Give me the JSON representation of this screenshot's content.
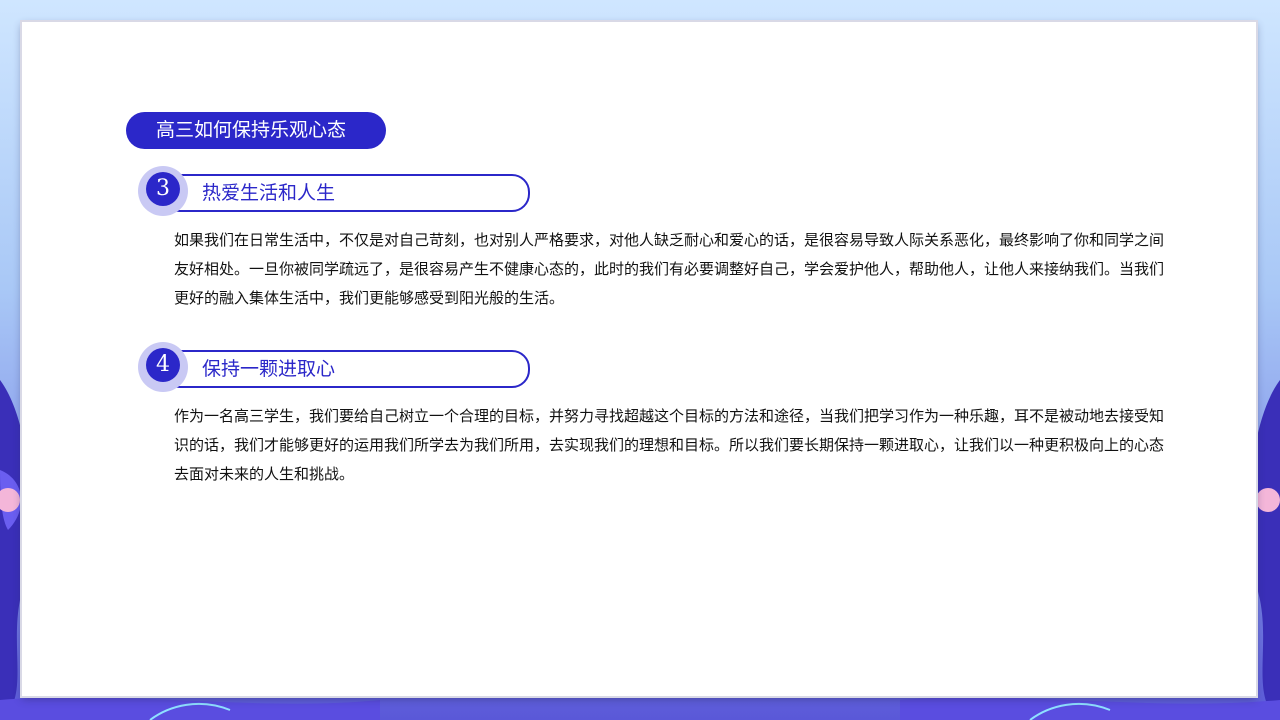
{
  "title": "高三如何保持乐观心态",
  "sections": [
    {
      "number": "3",
      "heading": "热爱生活和人生",
      "body": "如果我们在日常生活中，不仅是对自己苛刻，也对别人严格要求，对他人缺乏耐心和爱心的话，是很容易导致人际关系恶化，最终影响了你和同学之间友好相处。一旦你被同学疏远了，是很容易产生不健康心态的，此时的我们有必要调整好自己，学会爱护他人，帮助他人，让他人来接纳我们。当我们更好的融入集体生活中，我们更能够感受到阳光般的生活。"
    },
    {
      "number": "4",
      "heading": "保持一颗进取心",
      "body": "作为一名高三学生，我们要给自己树立一个合理的目标，并努力寻找超越这个目标的方法和途径，当我们把学习作为一种乐趣，耳不是被动地去接受知识的话，我们才能够更好的运用我们所学去为我们所用，去实现我们的理想和目标。所以我们要长期保持一颗进取心，让我们以一种更积极向上的心态去面对未来的人生和挑战。"
    }
  ],
  "colors": {
    "accent": "#2b27c9",
    "ring": "#c9c9f4",
    "text": "#111111"
  }
}
